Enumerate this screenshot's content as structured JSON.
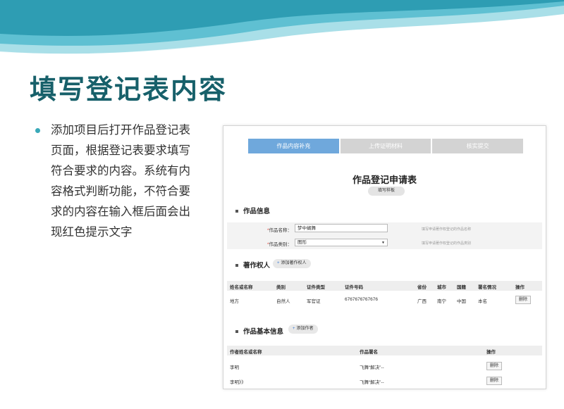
{
  "slide": {
    "title": "填写登记表内容",
    "bullet": "添加项目后打开作品登记表页面，根据登记表要求填写符合要求的内容。系统有内容格式判断功能，不符合要求的内容在输入框后面会出现红色提示文字"
  },
  "screenshot": {
    "tabs": [
      "作品内容补充",
      "上传证明材料",
      "核实提交"
    ],
    "active_tab": 0,
    "form_title": "作品登记申请表",
    "sample_button": "填写样板",
    "work_info": {
      "heading": "作品信息",
      "name_label": "作品名称：",
      "name_value": "梦中蝴舞",
      "name_hint": "填写申请著作权登记的作品名称",
      "type_label": "作品类别：",
      "type_value": "图形",
      "type_hint": "填写申请著作权登记的作品类别"
    },
    "copyright_owner": {
      "heading": "著作权人",
      "add_button": "添加著作权人",
      "headers": [
        "姓名或名称",
        "类别",
        "证件类型",
        "证件号码",
        "省份",
        "城市",
        "国籍",
        "署名情况",
        "操作"
      ],
      "rows": [
        [
          "地方",
          "自然人",
          "军官证",
          "6767676767676",
          "广西",
          "南宁",
          "中国",
          "本名",
          "删除"
        ]
      ]
    },
    "author_info": {
      "heading": "作品基本信息",
      "add_button": "添加作者",
      "headers": [
        "作者姓名或名称",
        "作品署名",
        "操作"
      ],
      "rows": [
        [
          "李明",
          "飞舞“解决”--",
          "删除"
        ],
        [
          "李明》》",
          "飞舞“解决”--",
          "删除"
        ]
      ]
    }
  },
  "colors": {
    "title": "#17606a",
    "wave_light": "#a9dfe8",
    "wave_dark": "#2e9db3",
    "active_tab": "#6fa8dc",
    "required": "#e0453a"
  }
}
